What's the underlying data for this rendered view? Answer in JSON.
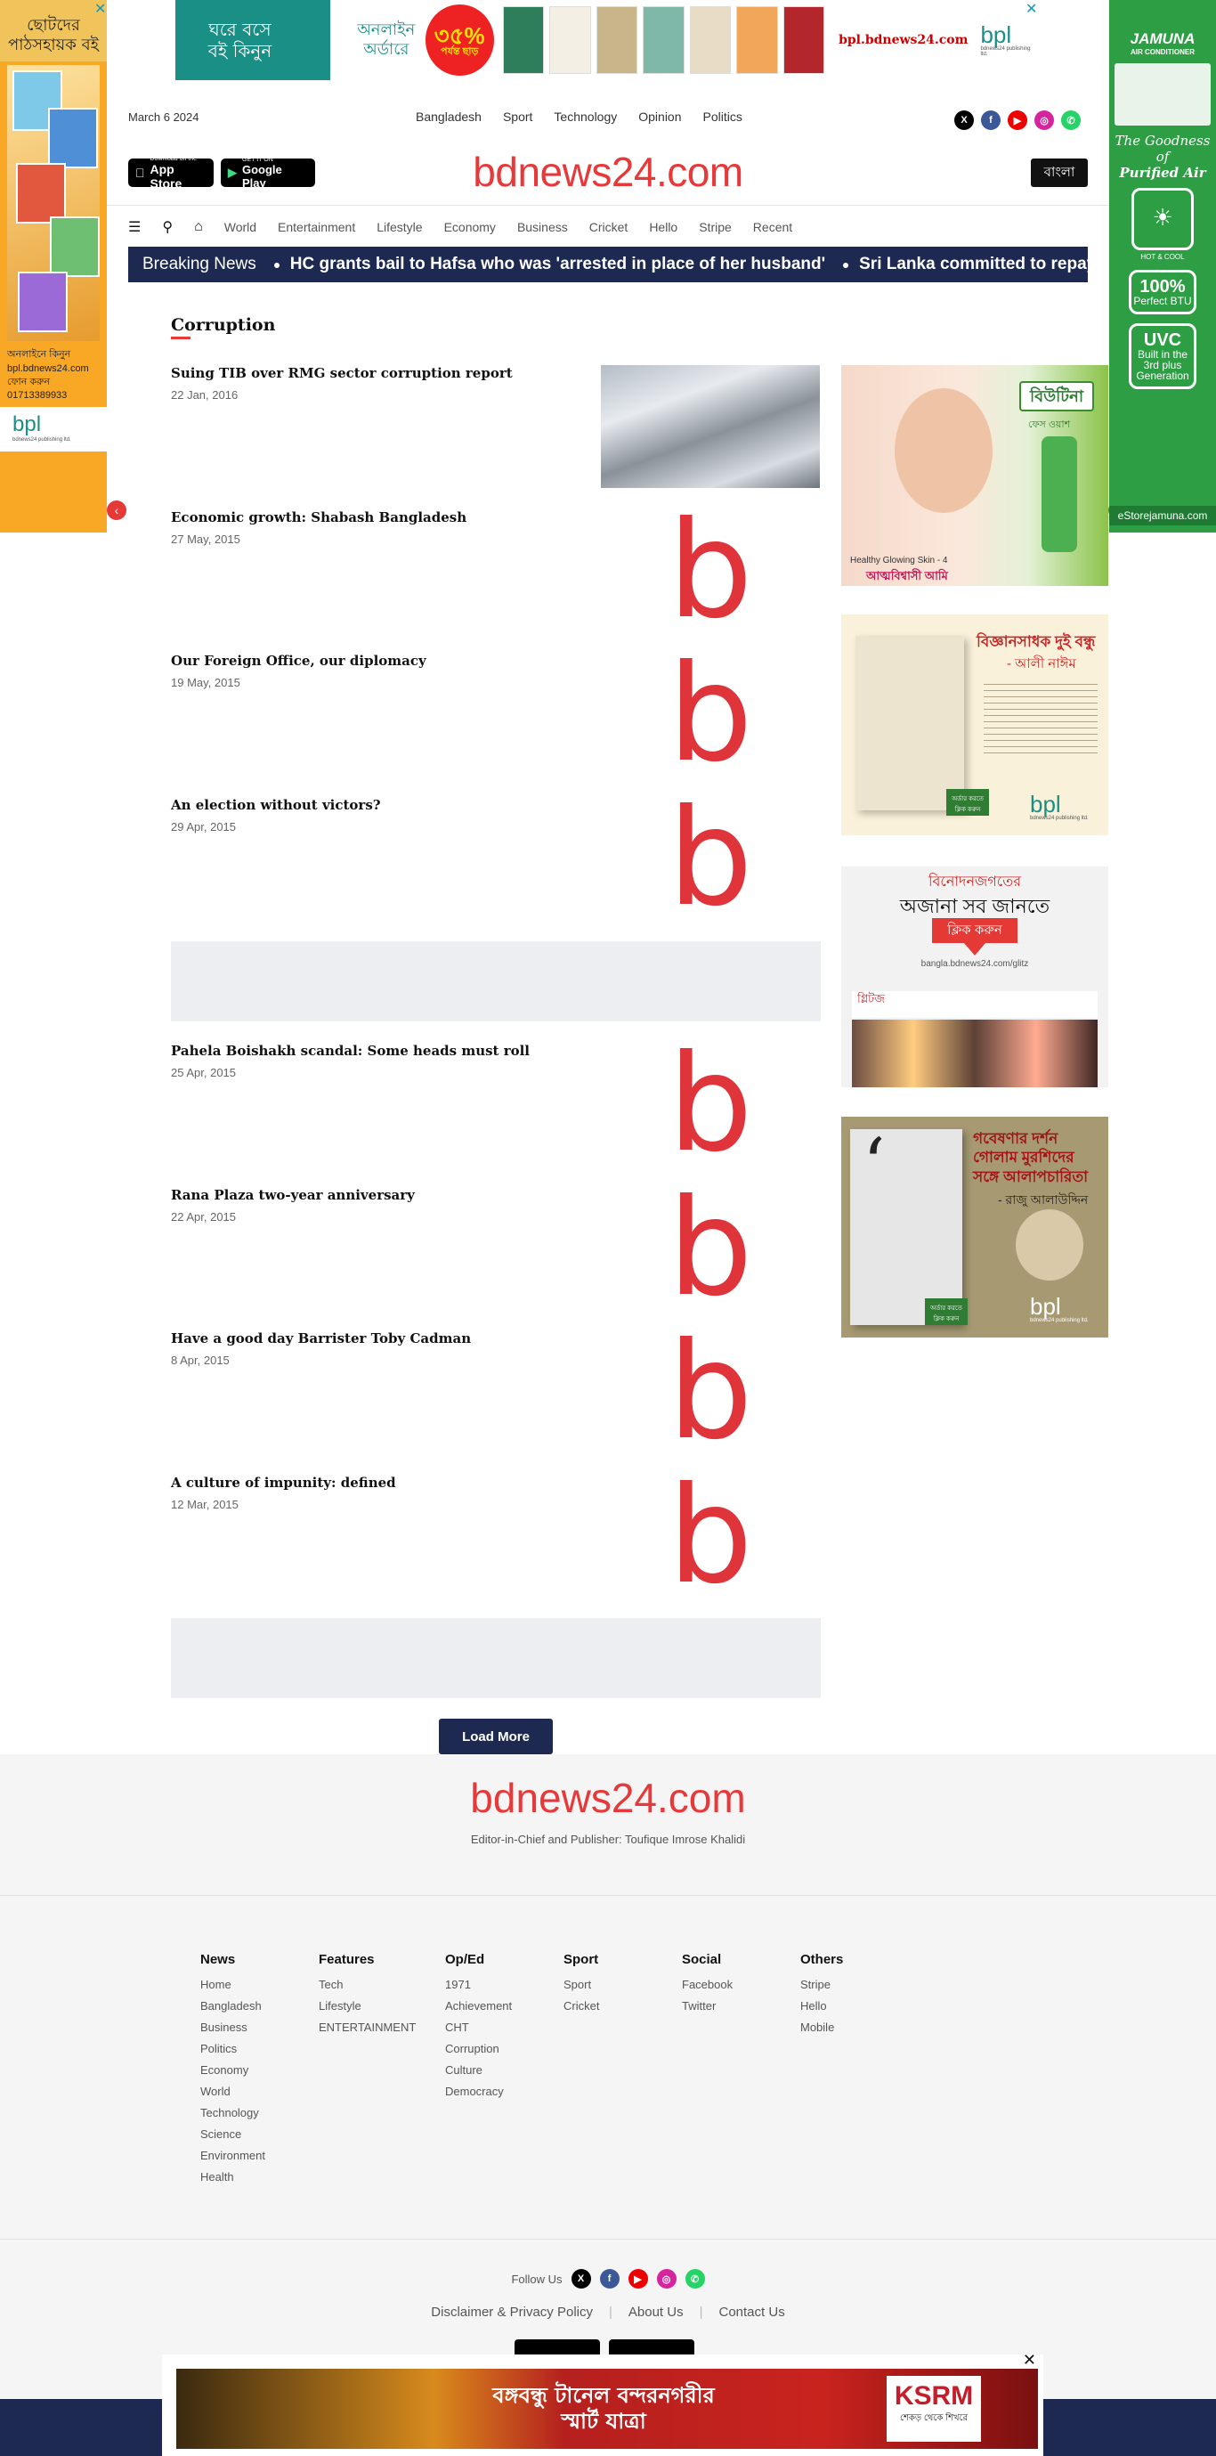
{
  "colors": {
    "brand_red": "#e8393a",
    "navy": "#1d2951",
    "teal": "#1a8f86",
    "ad_green": "#2d9e44",
    "ad_orange": "#f9a825"
  },
  "top_ad": {
    "line1": "ঘরে বসে",
    "line2": "বই কিনুন",
    "online": "অনলাইন অর্ডারে",
    "discount": "৩৫%",
    "discount_sub": "পর্যন্ত ছাড়",
    "url": "bpl.bdnews24.com",
    "brand": "bpl",
    "brand_sub": "bdnews24 publishing ltd.",
    "close": "✕"
  },
  "left_ad": {
    "title_line1": "ছোটদের",
    "title_line2": "পাঠসহায়ক বই",
    "info1": "অনলাইনে কিনুন",
    "info2": "bpl.bdnews24.com",
    "info3": "ফোন করুন",
    "info4": "01713389933",
    "brand": "bpl",
    "brand_sub": "bdnews24 publishing ltd.",
    "close": "✕"
  },
  "right_ad": {
    "brand": "JAMUNA",
    "brand_sub": "AIR CONDITIONER",
    "tagline1": "The Goodness of",
    "tagline2": "Purified Air",
    "hotcool": "HOT & COOL",
    "badge1_big": "100%",
    "badge1_small": "Perfect BTU",
    "badge2_big": "UVC",
    "badge2_small": "Built in the 3rd plus Generation",
    "footer": "eStorejamuna.com"
  },
  "header": {
    "date": "March 6 2024",
    "top_links": [
      "Bangladesh",
      "Sport",
      "Technology",
      "Opinion",
      "Politics"
    ],
    "app_store_small": "Download on the",
    "app_store": "App Store",
    "play_small": "GET IT ON",
    "play": "Google Play",
    "logo": "bdnews24.com",
    "lang_button": "বাংলা"
  },
  "social": {
    "x": "X",
    "facebook": "f",
    "youtube": "▶",
    "instagram": "◎",
    "whatsapp": "✆"
  },
  "nav": {
    "items": [
      "World",
      "Entertainment",
      "Lifestyle",
      "Economy",
      "Business",
      "Cricket",
      "Hello",
      "Stripe",
      "Recent"
    ]
  },
  "breaking": {
    "label": "Breaking News",
    "items": [
      "HC grants bail to Hafsa who was 'arrested in place of her husband'",
      "Sri Lanka committed to repaying"
    ]
  },
  "section": {
    "title": "Corruption"
  },
  "articles": [
    {
      "title": "Suing TIB over RMG sector corruption report",
      "date": "22 Jan, 2016"
    },
    {
      "title": "Economic growth: Shabash Bangladesh",
      "date": "27 May, 2015"
    },
    {
      "title": "Our Foreign Office, our diplomacy",
      "date": "19 May, 2015"
    },
    {
      "title": "An election without victors?",
      "date": "29 Apr, 2015"
    },
    {
      "title": "Pahela Boishakh scandal: Some heads must roll",
      "date": "25 Apr, 2015"
    },
    {
      "title": "Rana Plaza two-year anniversary",
      "date": "22 Apr, 2015"
    },
    {
      "title": "Have a good day Barrister Toby Cadman",
      "date": "8 Apr, 2015"
    },
    {
      "title": "A culture of impunity: defined",
      "date": "12 Mar, 2015"
    }
  ],
  "placeholder_logo": "b",
  "sidebar_ads": [
    {
      "brand": "বিউটিনা",
      "product": "ফেস ওয়াশ",
      "caption": "Healthy Glowing Skin - 4",
      "slogan": "আত্মবিশ্বাসী আমি"
    },
    {
      "title": "বিজ্ঞানসাধক দুই বন্ধু",
      "author": "- আলী নাঈম",
      "cta": "অর্ডার করতে ক্লিক করুন",
      "brand": "bpl",
      "brand_sub": "bdnews24 publishing ltd."
    },
    {
      "line1": "বিনোদনজগতের",
      "line2": "অজানা সব জানতে",
      "cta": "ক্লিক করুন",
      "url": "bangla.bdnews24.com/glitz",
      "site": "গ্লিটজ"
    },
    {
      "title": "গবেষণার দর্শন",
      "title2": "গোলাম মুরশিদের",
      "title3": "সঙ্গে আলাপচারিতা",
      "author": "- রাজু আলাউদ্দিন",
      "cta": "অর্ডার করতে ক্লিক করুন",
      "brand": "bpl",
      "brand_sub": "bdnews24 publishing ltd."
    }
  ],
  "load_more": "Load More",
  "footer": {
    "logo": "bdnews24.com",
    "editor": "Editor-in-Chief and Publisher: Toufique Imrose Khalidi",
    "columns": [
      {
        "title": "News",
        "links": [
          "Home",
          "Bangladesh",
          "Business",
          "Politics",
          "Economy",
          "World",
          "Technology",
          "Science",
          "Environment",
          "Health"
        ]
      },
      {
        "title": "Features",
        "links": [
          "Tech",
          "Lifestyle",
          "ENTERTAINMENT"
        ]
      },
      {
        "title": "Op/Ed",
        "links": [
          "1971",
          "Achievement",
          "CHT",
          "Corruption",
          "Culture",
          "Democracy"
        ]
      },
      {
        "title": "Sport",
        "links": [
          "Sport",
          "Cricket"
        ]
      },
      {
        "title": "Social",
        "links": [
          "Facebook",
          "Twitter"
        ]
      },
      {
        "title": "Others",
        "links": [
          "Stripe",
          "Hello",
          "Mobile"
        ]
      }
    ],
    "follow": "Follow Us",
    "links": [
      "Disclaimer & Privacy Policy",
      "About Us",
      "Contact Us"
    ]
  },
  "bottom_ad": {
    "line1": "বঙ্গবন্ধু টানেল বন্দরনগরীর",
    "line2": "স্মার্ট যাত্রা",
    "brand": "KSRM",
    "brand_sub": "শেকড় থেকে শিখরে",
    "close": "✕"
  }
}
